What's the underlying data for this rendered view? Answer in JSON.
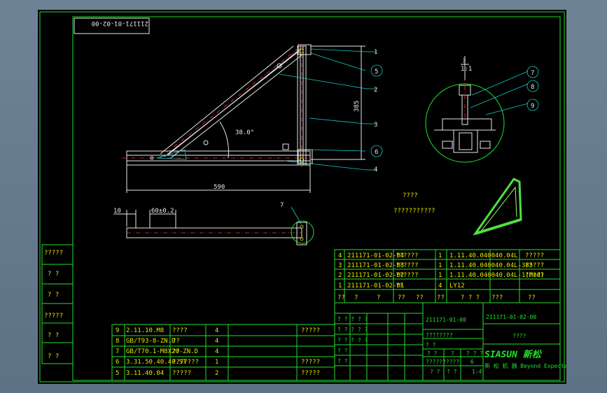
{
  "drawing_no_rotated": "211171-01-02-00",
  "dimensions": {
    "height": "385",
    "angle": "38.0°",
    "length": "590",
    "offset": "10",
    "spacing": "60±0.2",
    "detail_mark": "?",
    "detail_ratio": "1:1"
  },
  "balloons": [
    "1",
    "5",
    "2",
    "3",
    "6",
    "4",
    "7",
    "8",
    "9"
  ],
  "section_mark": "7",
  "tech_title": "????",
  "tech_note": "???????????",
  "left_block": [
    "?????",
    "?  ?",
    "?  ?",
    "?????",
    "?  ?",
    "?  ?"
  ],
  "parts_upper": [
    {
      "no": "4",
      "code": "211171-01-02-04",
      "name": "??????",
      "qty": "1",
      "spec": "1.11.40.040040.04L",
      "extra": "?????"
    },
    {
      "no": "3",
      "code": "211171-01-02-03",
      "name": "??????",
      "qty": "1",
      "spec": "1.11.40.040040.04L-385",
      "extra": "?????"
    },
    {
      "no": "2",
      "code": "211171-01-02-02",
      "name": "??????",
      "qty": "1",
      "spec": "1.11.40.040040.04L-1(Mod)",
      "extra": "?????"
    },
    {
      "no": "1",
      "code": "211171-01-02-01",
      "name": "??",
      "qty": "4",
      "spec": "LY12",
      "extra": ""
    }
  ],
  "parts_header": [
    "??",
    "?",
    "?",
    "??",
    "??",
    "??",
    "? ? ?",
    "???",
    "??"
  ],
  "parts_lower": [
    {
      "no": "9",
      "spec": "2.11.10.M8",
      "name": "????",
      "qty": "4",
      "extra": "?????"
    },
    {
      "no": "8",
      "spec": "GB/T93-8-ZN.D",
      "name": "??",
      "qty": "4",
      "extra": ""
    },
    {
      "no": "7",
      "spec": "GB/T70.1-M8X20-ZN.D",
      "name": "??",
      "qty": "4",
      "extra": ""
    },
    {
      "no": "6",
      "spec": "3.31.50.40.40.ST",
      "name": "???????",
      "qty": "1",
      "extra": "?????"
    },
    {
      "no": "5",
      "spec": "3.11.40.04",
      "name": "?????",
      "qty": "2",
      "extra": "?????"
    }
  ],
  "title_block": {
    "assembly_no": "211171-01-00",
    "drawing_no": "211171-01-02-00",
    "drawing_name": "????",
    "company_logo": "SIASUN 新松",
    "company_tagline": "新 松 机 器  Beyond Expectation",
    "sign_rows": [
      "? ? ? ? ?",
      "? ? ? ? ?",
      "? ? ? ? ?",
      "? ?",
      "? ?"
    ],
    "scale_labels": [
      "????????",
      "?   ?",
      "? ?",
      "?",
      "? ? ?",
      "??????????",
      "6",
      "1:4",
      "? ?",
      "? ?"
    ]
  }
}
